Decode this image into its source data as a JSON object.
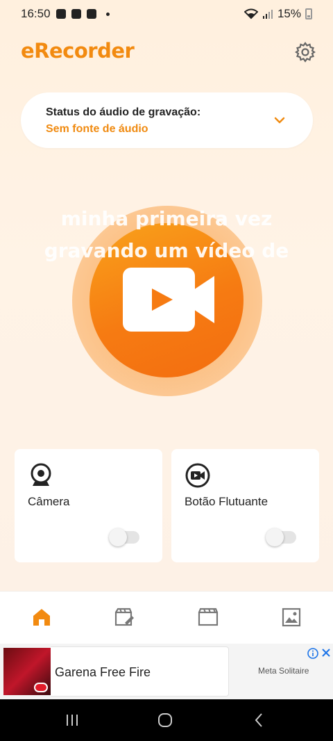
{
  "status_bar": {
    "time": "16:50",
    "battery": "15%",
    "notification_icons": [
      "alert-icon",
      "youtube-icon",
      "check-icon"
    ]
  },
  "header": {
    "app_name": "eRecorder",
    "settings_icon": "gear-icon"
  },
  "audio_status": {
    "title": "Status do áudio de gravação:",
    "value": "Sem fonte de áudio",
    "expand_icon": "chevron-down-icon"
  },
  "record": {
    "overlay_line1": "minha primeira vez",
    "overlay_line2": "gravando um vídeo de",
    "icon": "video-camera-play-icon"
  },
  "features": [
    {
      "label": "Câmera",
      "icon": "webcam-icon",
      "enabled": false
    },
    {
      "label": "Botão Flutuante",
      "icon": "floating-record-icon",
      "enabled": false
    }
  ],
  "bottom_nav": {
    "items": [
      {
        "icon": "home-icon",
        "active": true
      },
      {
        "icon": "edit-video-icon",
        "active": false
      },
      {
        "icon": "videos-icon",
        "active": false
      },
      {
        "icon": "gallery-icon",
        "active": false
      }
    ]
  },
  "ad": {
    "title": "Garena Free Fire",
    "sponsor": "Meta Solitaire"
  },
  "colors": {
    "accent": "#f28a10",
    "background": "#fff2e4",
    "record_outer": "#fcb876",
    "record_inner": "#f67b12"
  }
}
